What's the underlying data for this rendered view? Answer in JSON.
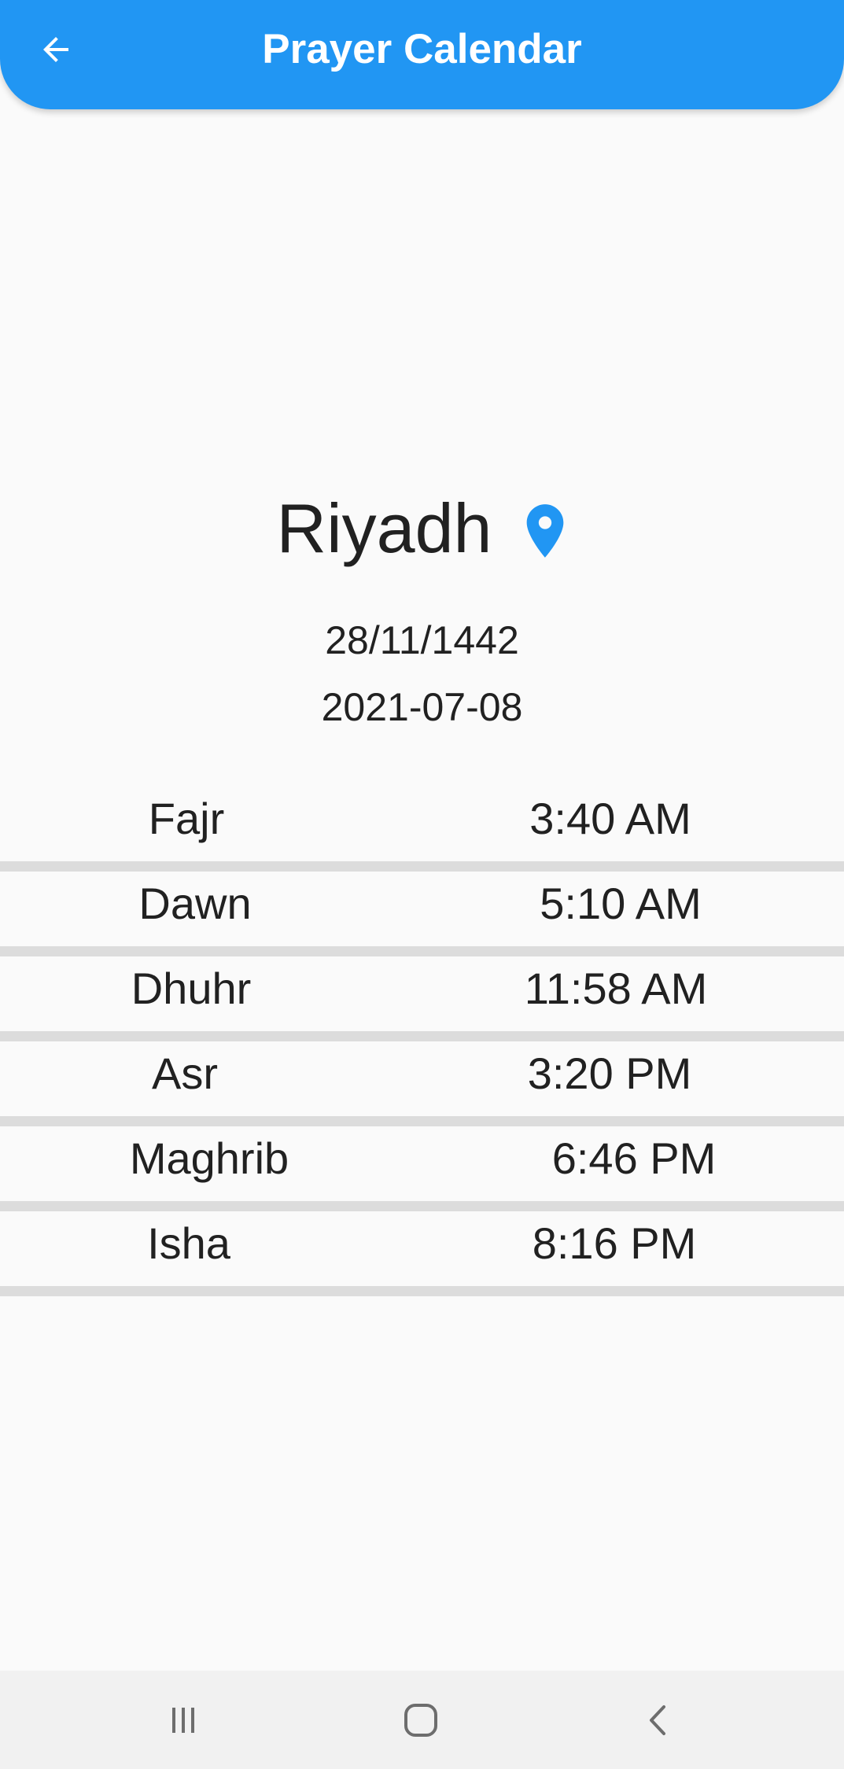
{
  "app_bar": {
    "title": "Prayer Calendar",
    "back_icon": "arrow-back-icon",
    "color": "#2196f3"
  },
  "location": {
    "city": "Riyadh",
    "icon": "location-pin-icon",
    "icon_color": "#2196f3"
  },
  "dates": {
    "hijri": "28/11/1442",
    "gregorian": "2021-07-08"
  },
  "prayers": [
    {
      "name": "Fajr",
      "time": "3:40 AM"
    },
    {
      "name": "Dawn",
      "time": "5:10 AM"
    },
    {
      "name": "Dhuhr",
      "time": "11:58 AM"
    },
    {
      "name": "Asr",
      "time": "3:20 PM"
    },
    {
      "name": "Maghrib",
      "time": "6:46 PM"
    },
    {
      "name": "Isha",
      "time": "8:16 PM"
    }
  ],
  "nav_bar": {
    "recents_icon": "recent-apps-icon",
    "home_icon": "home-icon",
    "back_icon": "back-chevron-icon"
  }
}
